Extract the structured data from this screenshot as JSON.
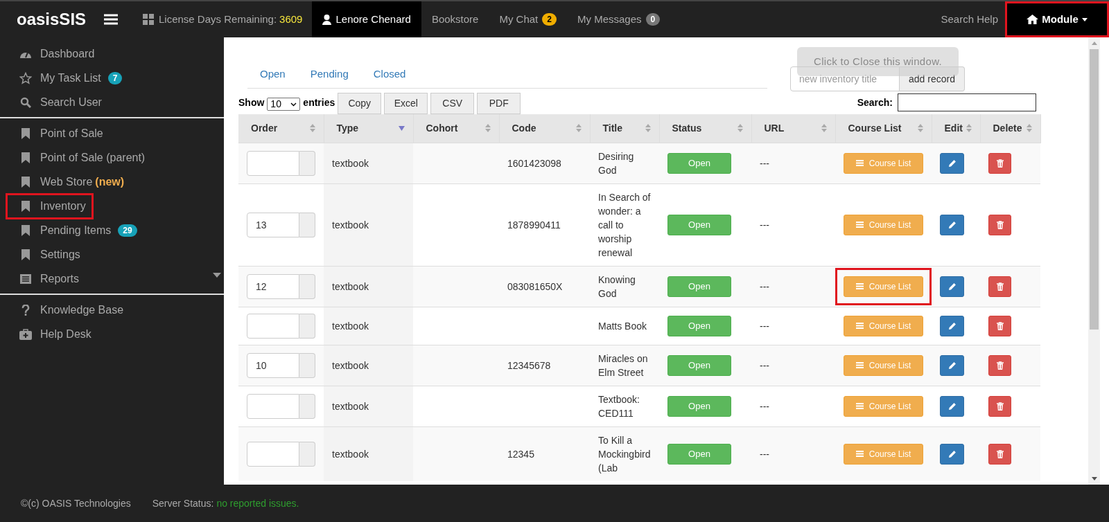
{
  "topbar": {
    "logo": "oasisSIS",
    "license_label": "License Days Remaining:",
    "license_days": "3609",
    "nav": [
      {
        "label": "Lenore Chenard",
        "kind": "user",
        "selected": true
      },
      {
        "label": "Bookstore",
        "kind": "link",
        "selected": false
      },
      {
        "label": "My Chat",
        "kind": "link",
        "badge": "2",
        "color": "#f0ad00",
        "selected": false
      },
      {
        "label": "My Messages",
        "kind": "link",
        "badge": "0",
        "color": "#777777",
        "selected": false
      }
    ],
    "search_help": "Search Help",
    "module": {
      "label": "Module",
      "highlighted": true
    }
  },
  "sidebar": {
    "groups": [
      [
        {
          "label": "Dashboard",
          "kind": "gauge",
          "highlighted": false
        },
        {
          "label": "My Task List",
          "kind": "star",
          "badge": "7",
          "highlighted": false
        },
        {
          "label": "Search User",
          "kind": "search",
          "highlighted": false
        }
      ],
      [
        {
          "label": "Point of Sale",
          "kind": "bookmark",
          "highlighted": false
        },
        {
          "label": "Point of Sale (parent)",
          "kind": "bookmark",
          "highlighted": false
        },
        {
          "label": "Web Store",
          "kind": "bookmark",
          "tag": "(new)",
          "highlighted": false
        },
        {
          "label": "Inventory",
          "kind": "bookmark",
          "highlighted": true
        },
        {
          "label": "Pending Items",
          "kind": "bookmark",
          "badge": "29",
          "highlighted": false
        },
        {
          "label": "Settings",
          "kind": "bookmark",
          "highlighted": false
        },
        {
          "label": "Reports",
          "kind": "list",
          "expandable": true,
          "highlighted": false
        }
      ],
      [
        {
          "label": "Knowledge Base",
          "kind": "question",
          "highlighted": false
        },
        {
          "label": "Help Desk",
          "kind": "medkit",
          "highlighted": false
        }
      ]
    ]
  },
  "content": {
    "tabs": [
      "Open",
      "Pending",
      "Closed"
    ],
    "tooltip": "Click to Close this window.",
    "new_title": {
      "placeholder": "new inventory title"
    },
    "add_record": "add record",
    "show_label": "Show",
    "page_size": "10",
    "entries_label": "entries",
    "export_buttons": [
      "Copy",
      "Excel",
      "CSV",
      "PDF"
    ],
    "search_label": "Search:",
    "table": {
      "columns": [
        {
          "label": "Order",
          "sorted": false
        },
        {
          "label": "Type",
          "sorted": true
        },
        {
          "label": "Cohort",
          "sorted": false
        },
        {
          "label": "Code",
          "sorted": false
        },
        {
          "label": "Title",
          "sorted": false
        },
        {
          "label": "Status",
          "sorted": false
        },
        {
          "label": "URL",
          "sorted": false
        },
        {
          "label": "Course List",
          "sorted": false
        },
        {
          "label": "Edit",
          "sorted": false
        },
        {
          "label": "Delete",
          "sorted": false
        }
      ],
      "rows": [
        {
          "order": "",
          "type": "textbook",
          "code": "1601423098",
          "title": "Desiring God",
          "status": "Open",
          "url": "---",
          "course_list": "Course List",
          "highlighted": false
        },
        {
          "order": "13",
          "type": "textbook",
          "code": "1878990411",
          "title": "In Search of wonder: a call to worship renewal",
          "status": "Open",
          "url": "---",
          "course_list": "Course List",
          "highlighted": false
        },
        {
          "order": "12",
          "type": "textbook",
          "code": "083081650X",
          "title": "Knowing God",
          "status": "Open",
          "url": "---",
          "course_list": "Course List",
          "highlighted": true
        },
        {
          "order": "",
          "type": "textbook",
          "code": "",
          "title": "Matts Book",
          "status": "Open",
          "url": "---",
          "course_list": "Course List",
          "highlighted": false
        },
        {
          "order": "10",
          "type": "textbook",
          "code": "12345678",
          "title": "Miracles on Elm Street",
          "status": "Open",
          "url": "---",
          "course_list": "Course List",
          "highlighted": false
        },
        {
          "order": "",
          "type": "textbook",
          "code": "",
          "title": "Textbook: CED111",
          "status": "Open",
          "url": "---",
          "course_list": "Course List",
          "highlighted": false
        },
        {
          "order": "",
          "type": "textbook",
          "code": "12345",
          "title": "To Kill a Mockingbird (Lab",
          "status": "Open",
          "url": "---",
          "course_list": "Course List",
          "highlighted": false
        }
      ]
    }
  },
  "footer": {
    "copyright": "©(c) OASIS Technologies",
    "server_label": "Server Status:",
    "server_status": "no reported issues."
  }
}
